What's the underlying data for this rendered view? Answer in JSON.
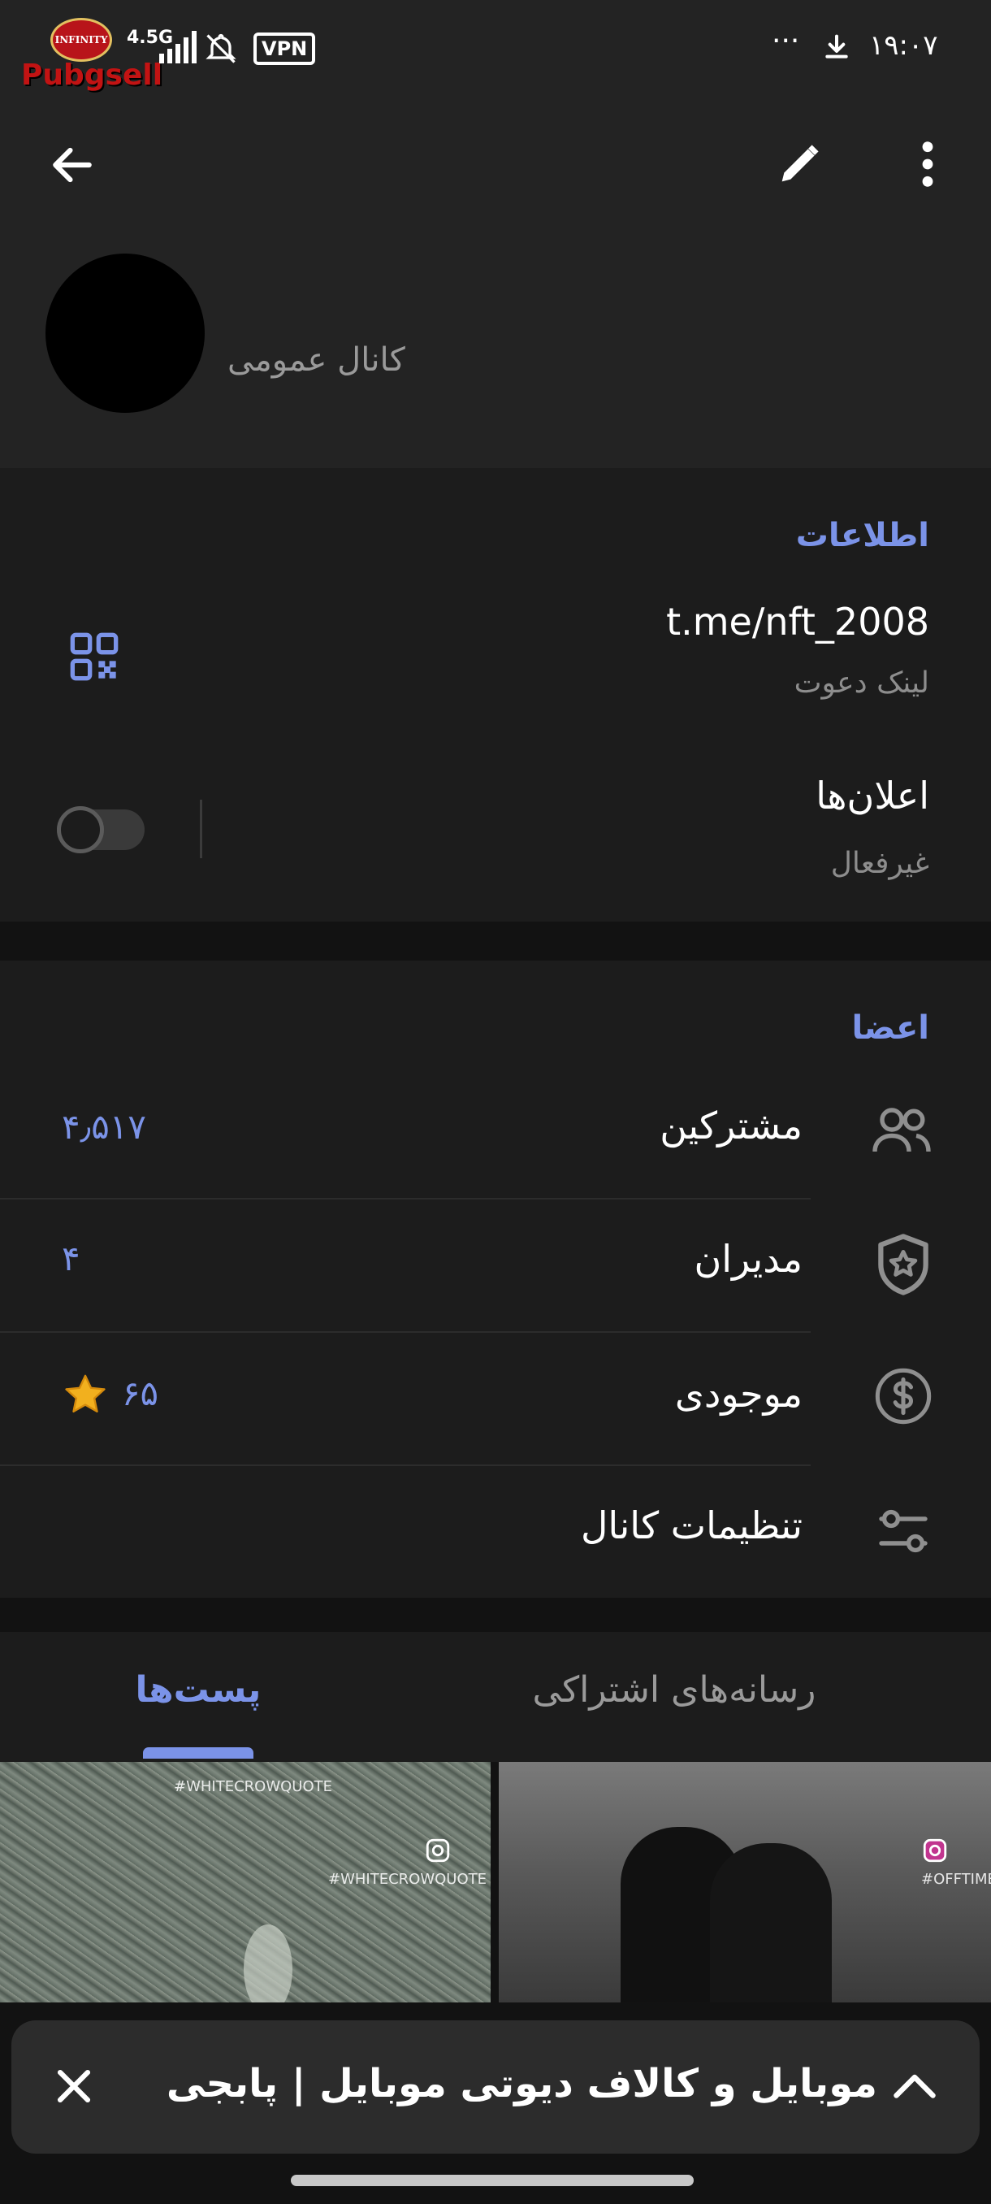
{
  "status_bar": {
    "time": "۱۹:۰۷",
    "more": "···",
    "network": "4.5G",
    "vpn": "VPN",
    "watermark_logo": "Pubgsell",
    "watermark_badge": "INFINITY"
  },
  "header": {
    "channel_type": "کانال عمومی"
  },
  "info": {
    "title": "اطلاعات",
    "link": "t.me/nft_2008",
    "link_caption": "لینک دعوت",
    "notifications_label": "اعلان‌ها",
    "notifications_state": "غیرفعال",
    "notifications_enabled": false
  },
  "members": {
    "title": "اعضا",
    "rows": [
      {
        "label": "مشترکین",
        "value": "۴٫۵۱۷",
        "icon": "people-icon"
      },
      {
        "label": "مدیران",
        "value": "۴",
        "icon": "shield-star-icon"
      },
      {
        "label": "موجودی",
        "value": "۶۵",
        "icon": "dollar-circle-icon",
        "extra_icon": "star-icon"
      },
      {
        "label": "تنظیمات کانال",
        "value": "",
        "icon": "sliders-icon"
      }
    ]
  },
  "tabs": {
    "shared_media": "رسانه‌های اشتراکی",
    "posts": "پست‌ها",
    "active": "posts"
  },
  "thumbnails": [
    {
      "watermark_top": "#WHITECROWQUOTE",
      "watermark": "#WHITECROWQUOTE"
    },
    {
      "watermark": "#OFFTIMES"
    }
  ],
  "player": {
    "title": "موبایل و کالاف دیوتی موبایل | پابجی سل"
  },
  "colors": {
    "accent": "#7b93e8",
    "background": "#121212",
    "surface": "#1c1c1c",
    "header": "#232323"
  }
}
